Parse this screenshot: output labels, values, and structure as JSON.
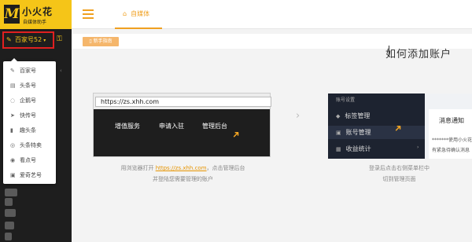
{
  "brand": {
    "mark": "M",
    "title": "小火花",
    "subtitle": "自媒体助手"
  },
  "account_selector": {
    "label": "百家号52",
    "caret": "▾"
  },
  "platform_menu": [
    {
      "label": "百家号",
      "icon": "pen-icon"
    },
    {
      "label": "头条号",
      "icon": "document-icon"
    },
    {
      "label": "企鹅号",
      "icon": "penguin-icon"
    },
    {
      "label": "快传号",
      "icon": "send-icon"
    },
    {
      "label": "趣头条",
      "icon": "bookmark-icon"
    },
    {
      "label": "头条特卖",
      "icon": "gift-icon"
    },
    {
      "label": "看点号",
      "icon": "eye-icon"
    },
    {
      "label": "爱奇艺号",
      "icon": "video-icon"
    }
  ],
  "topbar": {
    "tab_label": "自媒体"
  },
  "guide_button": "新手指南",
  "guide_title": "如何添加账户",
  "step1": {
    "url": "https://zs.xhh.com",
    "menu": [
      "增值服务",
      "申请入驻",
      "管理后台"
    ],
    "caption_pre": "用浏览器打开",
    "caption_link": "https://zs.xhh.com",
    "caption_post": "，点击管理后台",
    "caption_line2": "并登陆您需要管理的账户"
  },
  "step2": {
    "header": "账号设置",
    "menu": [
      "标签管理",
      "账号管理",
      "收益统计"
    ],
    "notice_title": "消息通知",
    "notice_line1": "*******使用小火花",
    "notice_line2": "有紧急待确认消息",
    "caption_line1": "登录后点击右侧菜单栏中",
    "caption_line2": "切到管理页面"
  },
  "colors": {
    "brand_yellow": "#f5c518",
    "accent_orange": "#f0a020",
    "highlight_red": "#e02020",
    "sidebar_bg": "#1e1e1e"
  }
}
